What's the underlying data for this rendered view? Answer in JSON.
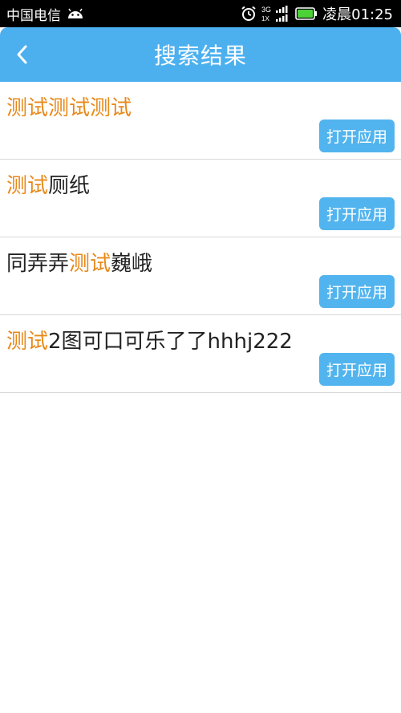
{
  "status_bar": {
    "carrier": "中国电信",
    "time": "凌晨01:25",
    "network_top": "3G",
    "network_bottom": "1X"
  },
  "header": {
    "title": "搜索结果",
    "back_icon": "chevron-left-icon"
  },
  "colors": {
    "title_bar": "#4cb0ef",
    "highlight": "#e8891a",
    "button": "#52b4ee",
    "battery": "#4cd137"
  },
  "results": [
    {
      "segments": [
        {
          "text": "测试测试测试",
          "hl": true
        }
      ],
      "button": "打开应用"
    },
    {
      "segments": [
        {
          "text": "测试",
          "hl": true
        },
        {
          "text": "厕纸",
          "hl": false
        }
      ],
      "button": "打开应用"
    },
    {
      "segments": [
        {
          "text": "同弄弄",
          "hl": false
        },
        {
          "text": "测试",
          "hl": true
        },
        {
          "text": "巍峨",
          "hl": false
        }
      ],
      "button": "打开应用"
    },
    {
      "segments": [
        {
          "text": "测试",
          "hl": true
        },
        {
          "text": "2图可口可乐了了hhhj222",
          "hl": false
        }
      ],
      "button": "打开应用"
    }
  ]
}
